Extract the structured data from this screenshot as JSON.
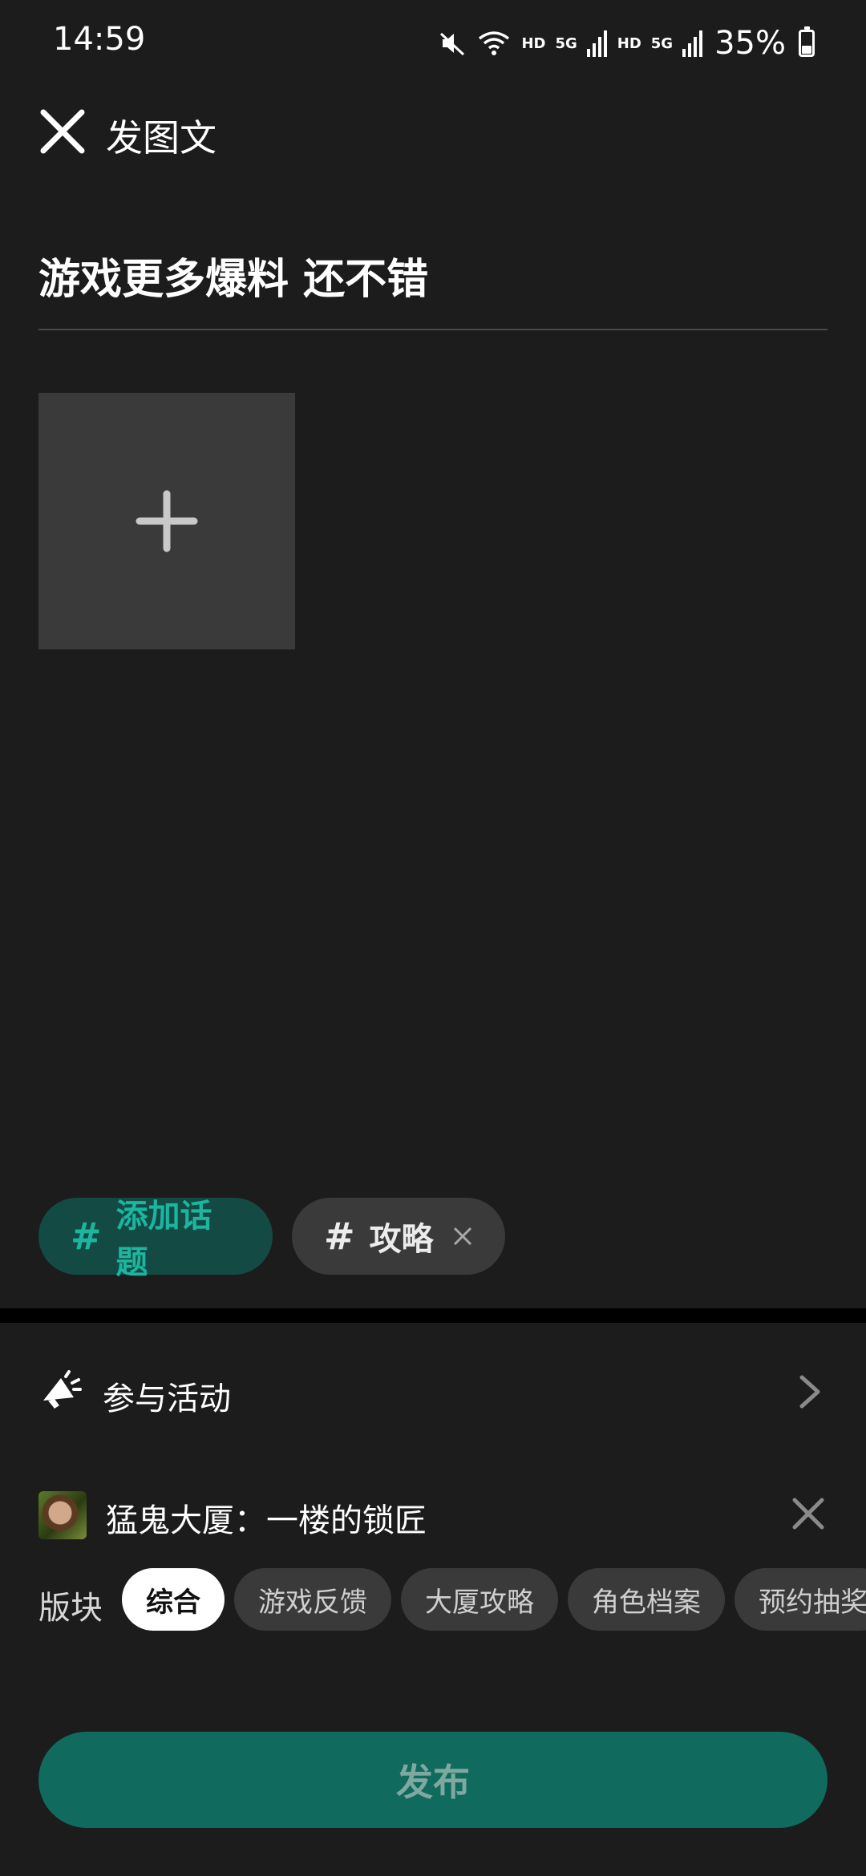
{
  "status_bar": {
    "time": "14:59",
    "hd1": "HD",
    "net1": "5G",
    "hd2": "HD",
    "net2": "5G",
    "battery": "35%",
    "battery_level": 0.35
  },
  "header": {
    "title": "发图文"
  },
  "post": {
    "title": "游戏更多爆料 还不错"
  },
  "topics": {
    "add_label": "添加话题",
    "hash": "#",
    "selected": [
      {
        "label": "攻略"
      }
    ]
  },
  "activity": {
    "label": "参与活动"
  },
  "game": {
    "name": "猛鬼大厦：一楼的锁匠"
  },
  "sections": {
    "label": "版块",
    "items": [
      "综合",
      "游戏反馈",
      "大厦攻略",
      "角色档案",
      "预约抽奖"
    ],
    "selected": "综合"
  },
  "publish": {
    "label": "发布"
  },
  "colors": {
    "background": "#1c1c1c",
    "accent": "#1cb5a0",
    "accent_bg": "#134a44",
    "publish_bg": "#116a5e"
  }
}
